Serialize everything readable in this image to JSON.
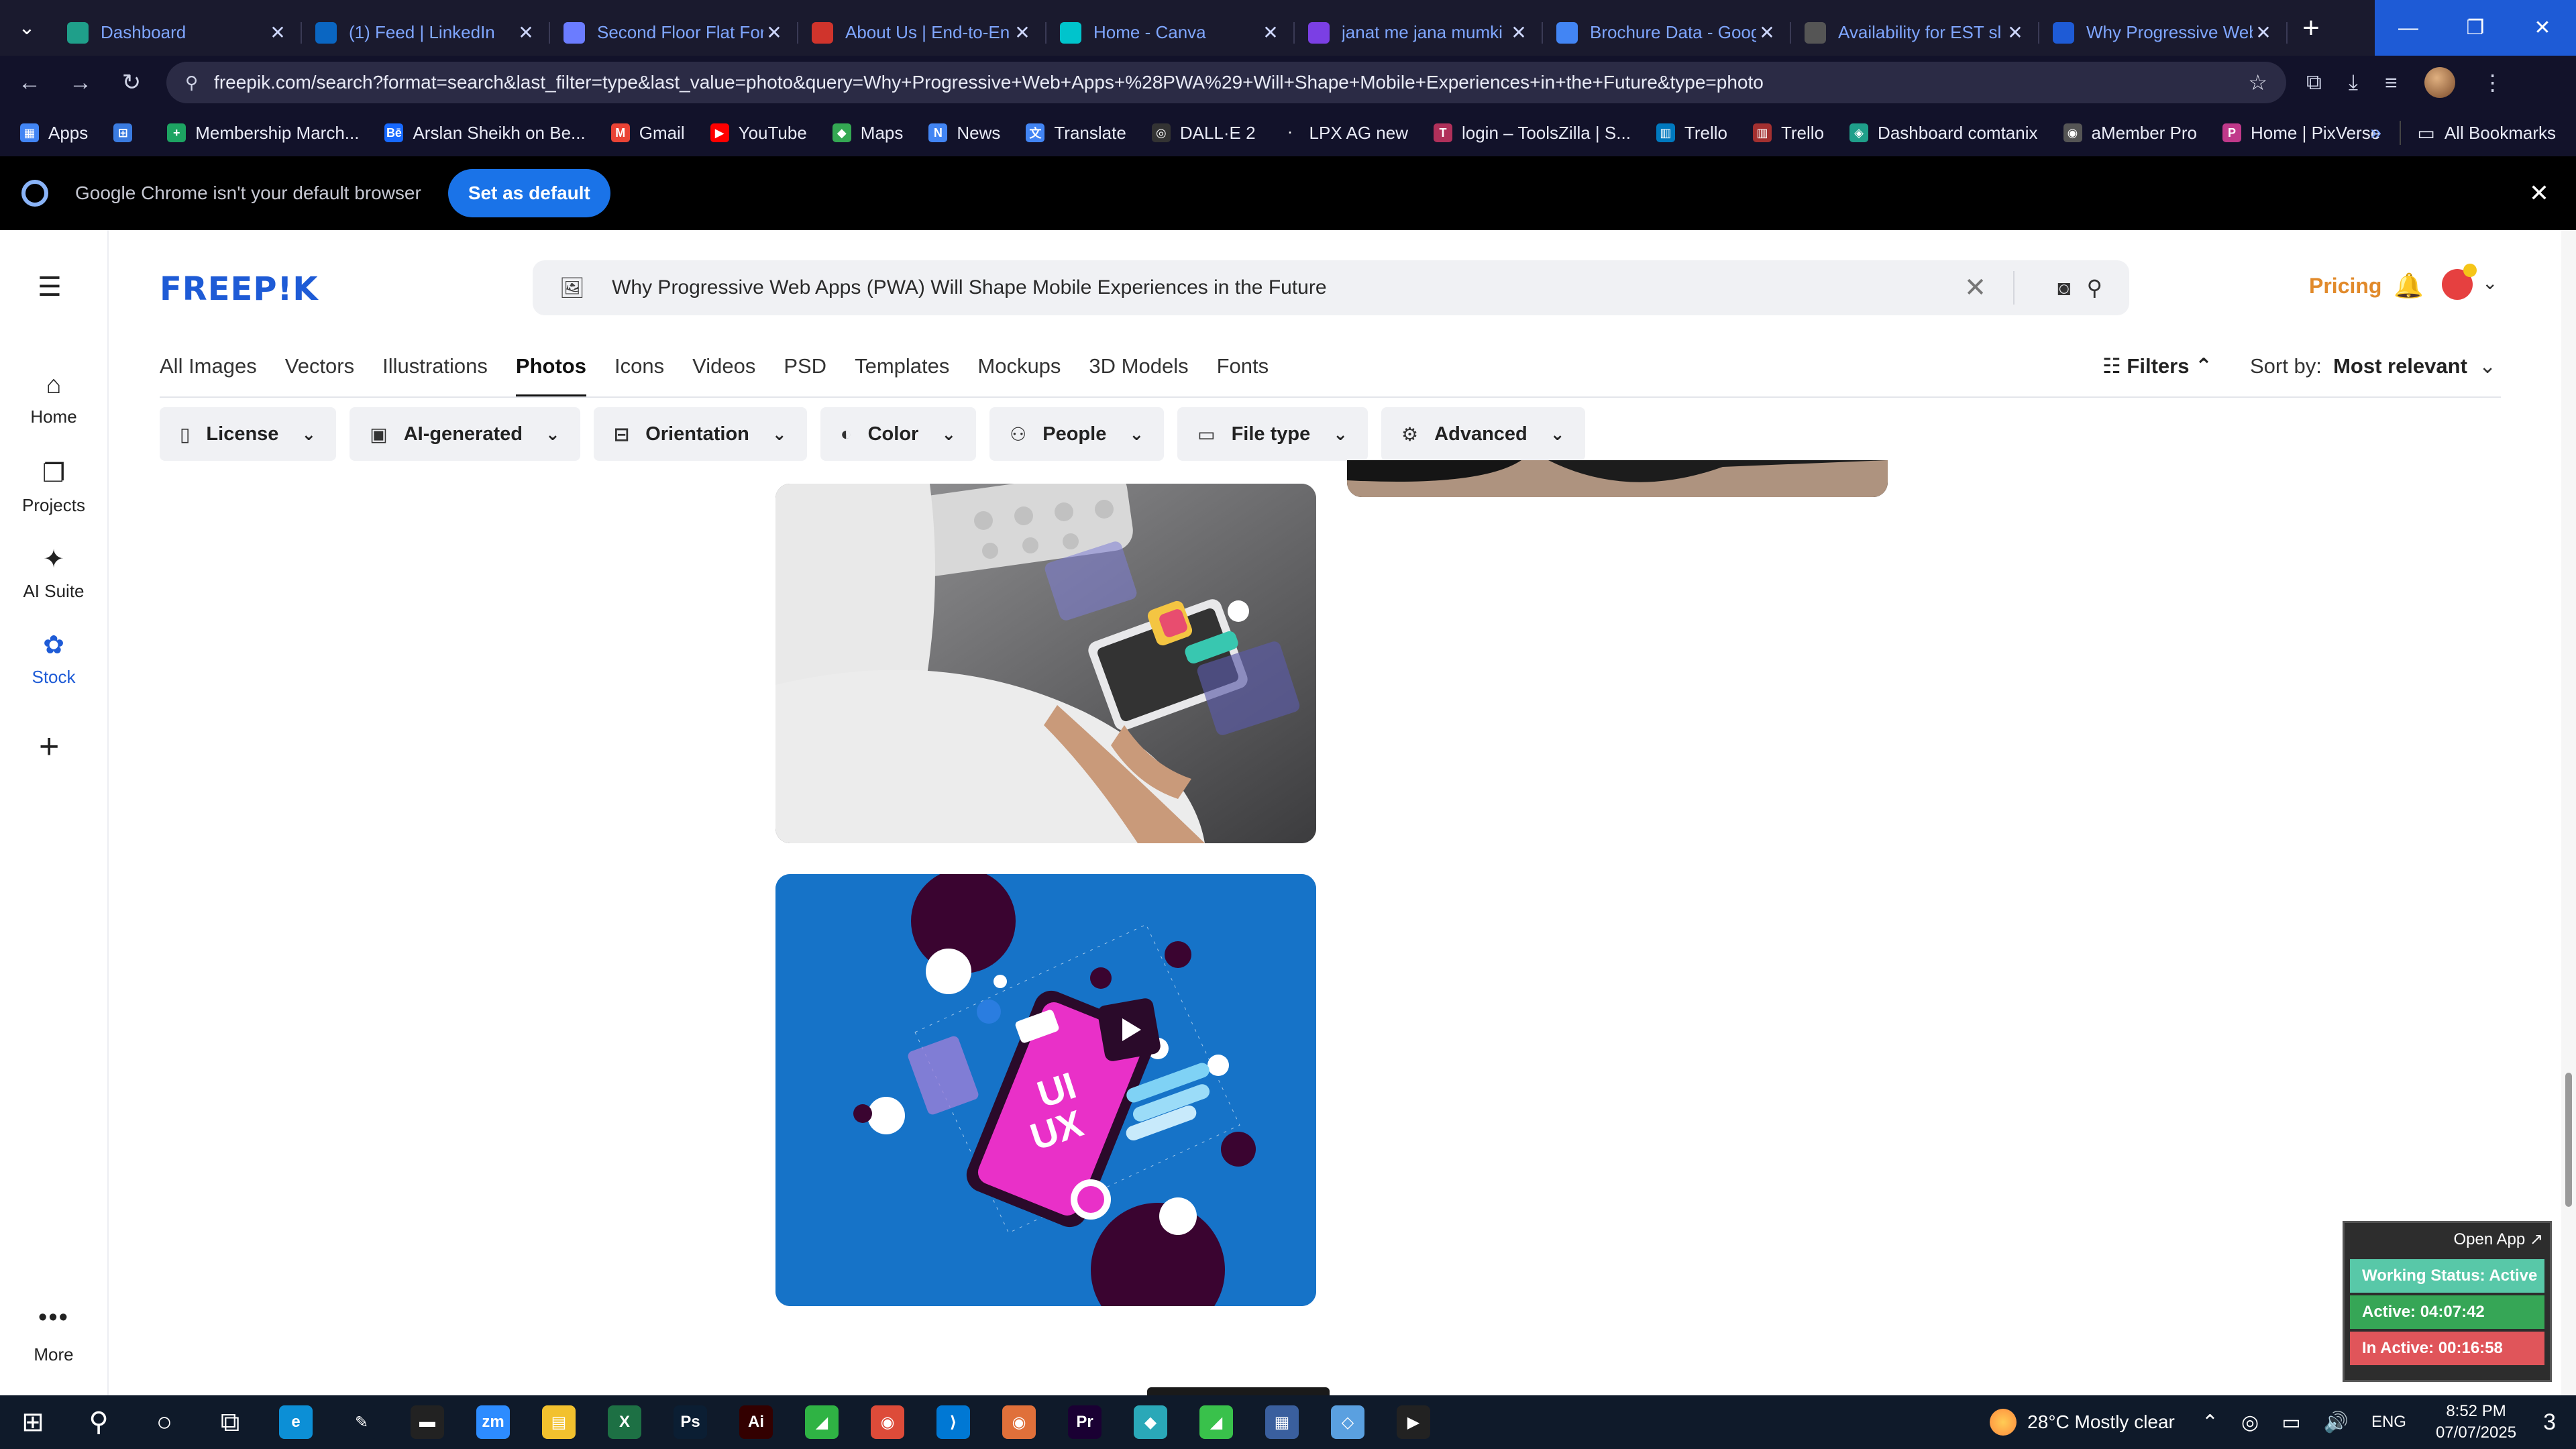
{
  "browser": {
    "tabs": [
      {
        "title": "Dashboard",
        "fav_color": "#1f9f8a",
        "icon": "dashboard-icon"
      },
      {
        "title": "(1) Feed | LinkedIn",
        "fav_color": "#0a66c2",
        "icon": "linkedin-icon"
      },
      {
        "title": "Second Floor Flat For",
        "fav_color": "#6b7cff",
        "icon": "property-icon"
      },
      {
        "title": "About Us | End-to-En",
        "fav_color": "#d0342c",
        "icon": "company-icon"
      },
      {
        "title": "Home - Canva",
        "fav_color": "#00c4cc",
        "icon": "canva-icon"
      },
      {
        "title": "janat me jana mumki",
        "fav_color": "#7b3fe4",
        "icon": "video-icon"
      },
      {
        "title": "Brochure Data - Goog",
        "fav_color": "#4285f4",
        "icon": "docs-icon"
      },
      {
        "title": "Availability for EST sl",
        "fav_color": "#555555",
        "icon": "calendar-icon"
      },
      {
        "title": "Why Progressive Web",
        "fav_color": "#1e5bd6",
        "icon": "freepik-icon"
      }
    ],
    "url": "freepik.com/search?format=search&last_filter=type&last_value=photo&query=Why+Progressive+Web+Apps+%28PWA%29+Will+Shape+Mobile+Experiences+in+the+Future&type=photo",
    "bookmarks": [
      {
        "label": "Apps",
        "color": "#4285f4",
        "glyph": "▦"
      },
      {
        "label": "",
        "color": "#3a7be0",
        "glyph": "⊞"
      },
      {
        "label": "Membership March...",
        "color": "#1da462",
        "glyph": "+"
      },
      {
        "label": "Arslan Sheikh on Be...",
        "color": "#1769ff",
        "glyph": "Bē"
      },
      {
        "label": "Gmail",
        "color": "#ea4335",
        "glyph": "M"
      },
      {
        "label": "YouTube",
        "color": "#ff0000",
        "glyph": "▶"
      },
      {
        "label": "Maps",
        "color": "#34a853",
        "glyph": "◆"
      },
      {
        "label": "News",
        "color": "#4285f4",
        "glyph": "N"
      },
      {
        "label": "Translate",
        "color": "#4285f4",
        "glyph": "文"
      },
      {
        "label": "DALL·E 2",
        "color": "#333333",
        "glyph": "◎"
      },
      {
        "label": "LPX AG new",
        "color": "#12122a",
        "glyph": "·"
      },
      {
        "label": "login – ToolsZilla | S...",
        "color": "#b0305a",
        "glyph": "T"
      },
      {
        "label": "Trello",
        "color": "#0079bf",
        "glyph": "▥"
      },
      {
        "label": "Trello",
        "color": "#a33030",
        "glyph": "▥"
      },
      {
        "label": "Dashboard comtanix",
        "color": "#1f9f8a",
        "glyph": "◈"
      },
      {
        "label": "aMember Pro",
        "color": "#555555",
        "glyph": "◉"
      },
      {
        "label": "Home | PixVerse",
        "color": "#c0398a",
        "glyph": "P"
      }
    ],
    "all_bookmarks": "All Bookmarks",
    "infobar_text": "Google Chrome isn't your default browser",
    "set_default": "Set as default"
  },
  "site": {
    "logo": "FREEP!K",
    "search_query": "Why Progressive Web Apps (PWA) Will Shape Mobile Experiences in the Future",
    "pricing": "Pricing",
    "nav": [
      {
        "label": "Home",
        "icon": "home-icon",
        "glyph": "⌂"
      },
      {
        "label": "Projects",
        "icon": "projects-icon",
        "glyph": "❐"
      },
      {
        "label": "AI Suite",
        "icon": "ai-suite-icon",
        "glyph": "✦"
      },
      {
        "label": "Stock",
        "icon": "stock-icon",
        "glyph": "✿"
      }
    ],
    "more": "More",
    "type_tabs": [
      "All Images",
      "Vectors",
      "Illustrations",
      "Photos",
      "Icons",
      "Videos",
      "PSD",
      "Templates",
      "Mockups",
      "3D Models",
      "Fonts"
    ],
    "active_type_tab": "Photos",
    "filters": "Filters",
    "sort_label": "Sort by:",
    "sort_value": "Most relevant",
    "chips": [
      {
        "label": "License",
        "icon": "license-icon",
        "glyph": "▯"
      },
      {
        "label": "AI-generated",
        "icon": "ai-generated-icon",
        "glyph": "▣"
      },
      {
        "label": "Orientation",
        "icon": "orientation-icon",
        "glyph": "⊟"
      },
      {
        "label": "Color",
        "icon": "palette-icon",
        "glyph": "◐"
      },
      {
        "label": "People",
        "icon": "people-icon",
        "glyph": "⚇"
      },
      {
        "label": "File type",
        "icon": "file-icon",
        "glyph": "▭"
      },
      {
        "label": "Advanced",
        "icon": "advanced-settings-icon",
        "glyph": "⚙"
      }
    ]
  },
  "photo2_text": {
    "line1": "UI",
    "line2": "UX"
  },
  "tracker": {
    "open_app": "Open App ↗",
    "status": "Working Status: Active",
    "active": "Active: 04:07:42",
    "inactive": "In Active: 00:16:58"
  },
  "taskbar": {
    "apps": [
      {
        "name": "edge-icon",
        "color": "#0c8fd6",
        "glyph": "e"
      },
      {
        "name": "pen-icon",
        "color": "#0f1a2a",
        "glyph": "✎"
      },
      {
        "name": "terminal-icon",
        "color": "#222222",
        "glyph": "▬"
      },
      {
        "name": "zoom-icon",
        "color": "#2d8cff",
        "glyph": "zm"
      },
      {
        "name": "file-explorer-icon",
        "color": "#f2c12e",
        "glyph": "▤"
      },
      {
        "name": "excel-icon",
        "color": "#1d7044",
        "glyph": "X"
      },
      {
        "name": "photoshop-icon",
        "color": "#0b1e33",
        "glyph": "Ps"
      },
      {
        "name": "illustrator-icon",
        "color": "#330000",
        "glyph": "Ai"
      },
      {
        "name": "app-green-icon",
        "color": "#2fb344",
        "glyph": "◢"
      },
      {
        "name": "chrome-icon",
        "color": "#dd4b39",
        "glyph": "◉"
      },
      {
        "name": "vscode-icon",
        "color": "#0078d4",
        "glyph": "⟩"
      },
      {
        "name": "chrome-profile-icon",
        "color": "#e0703a",
        "glyph": "◉"
      },
      {
        "name": "premiere-icon",
        "color": "#1a0033",
        "glyph": "Pr"
      },
      {
        "name": "app-teal-icon",
        "color": "#2aa8b8",
        "glyph": "◆"
      },
      {
        "name": "app-green2-icon",
        "color": "#39c14b",
        "glyph": "◢"
      },
      {
        "name": "calculator-icon",
        "color": "#3a5f9e",
        "glyph": "▦"
      },
      {
        "name": "app-blue-icon",
        "color": "#5aa0e0",
        "glyph": "◇"
      },
      {
        "name": "media-player-icon",
        "color": "#222222",
        "glyph": "▶"
      }
    ],
    "weather": "28°C  Mostly clear",
    "lang": "ENG",
    "time": "8:52 PM",
    "date": "07/07/2025",
    "notif_count": "3"
  }
}
